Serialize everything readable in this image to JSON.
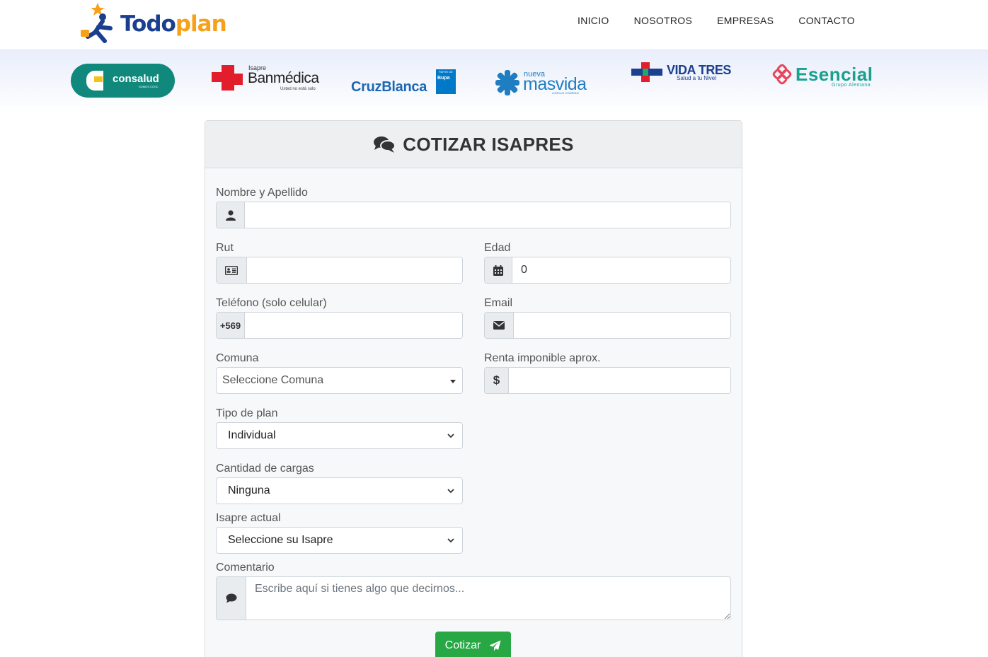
{
  "header": {
    "logo": {
      "word1": "Todo",
      "word2": "plan"
    },
    "nav": [
      "INICIO",
      "NOSOTROS",
      "EMPRESAS",
      "CONTACTO"
    ]
  },
  "brands": {
    "consalud": {
      "name": "consalud",
      "tag": "SOMOS CCHC"
    },
    "banmedica": {
      "pre": "Isapre",
      "name": "Banmédica",
      "slogan": "Usted no está solo"
    },
    "cruzblanca": {
      "name": "CruzBlanca",
      "badge1": "PARTE DE",
      "badge2": "Bupa"
    },
    "masvida": {
      "pre": "nueva",
      "name": "masvida",
      "tag": "A NEXUS COMPANY"
    },
    "vidatres": {
      "name": "VIDA TRES",
      "slogan": "Salud a tu Nivel"
    },
    "esencial": {
      "name": "Esencial",
      "tag": "Grupo Alemana"
    }
  },
  "form": {
    "title": "COTIZAR ISAPRES",
    "nombre_label": "Nombre y Apellido",
    "rut_label": "Rut",
    "edad_label": "Edad",
    "edad_value": "0",
    "telefono_label": "Teléfono (solo celular)",
    "telefono_prefix": "+569",
    "email_label": "Email",
    "comuna_label": "Comuna",
    "comuna_value": "Seleccione Comuna",
    "renta_label": "Renta imponible aprox.",
    "renta_prefix": "$",
    "tipo_label": "Tipo de plan",
    "tipo_value": "Individual",
    "cargas_label": "Cantidad de cargas",
    "cargas_value": "Ninguna",
    "isapre_label": "Isapre actual",
    "isapre_value": "Seleccione su Isapre",
    "comentario_label": "Comentario",
    "comentario_placeholder": "Escribe aquí si tienes algo que decirnos...",
    "submit_label": "Cotizar"
  }
}
